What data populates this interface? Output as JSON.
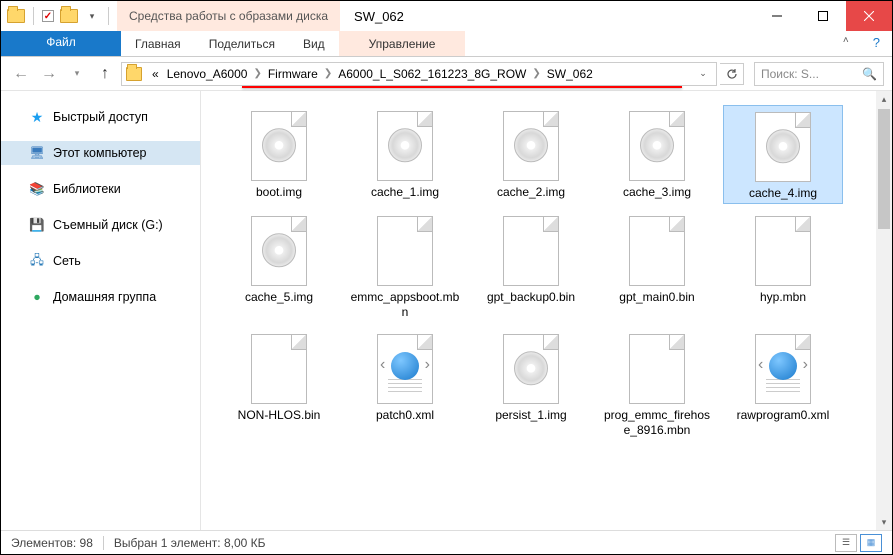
{
  "title_context": "Средства работы с образами диска",
  "title": "SW_062",
  "ribbon": {
    "file": "Файл",
    "home": "Главная",
    "share": "Поделиться",
    "view": "Вид",
    "manage": "Управление"
  },
  "breadcrumb": {
    "prefix": "«",
    "parts": [
      "Lenovo_A6000",
      "Firmware",
      "A6000_L_S062_161223_8G_ROW",
      "SW_062"
    ]
  },
  "search": {
    "placeholder": "Поиск: S..."
  },
  "nav": {
    "quick": "Быстрый доступ",
    "pc": "Этот компьютер",
    "libs": "Библиотеки",
    "removable": "Съемный диск (G:)",
    "network": "Сеть",
    "homegroup": "Домашняя группа"
  },
  "files": [
    {
      "name": "boot.img",
      "type": "disc"
    },
    {
      "name": "cache_1.img",
      "type": "disc"
    },
    {
      "name": "cache_2.img",
      "type": "disc"
    },
    {
      "name": "cache_3.img",
      "type": "disc"
    },
    {
      "name": "cache_4.img",
      "type": "disc",
      "selected": true
    },
    {
      "name": "cache_5.img",
      "type": "disc"
    },
    {
      "name": "emmc_appsboot.mbn",
      "type": "blank"
    },
    {
      "name": "gpt_backup0.bin",
      "type": "blank"
    },
    {
      "name": "gpt_main0.bin",
      "type": "blank"
    },
    {
      "name": "hyp.mbn",
      "type": "blank"
    },
    {
      "name": "NON-HLOS.bin",
      "type": "blank"
    },
    {
      "name": "patch0.xml",
      "type": "xml"
    },
    {
      "name": "persist_1.img",
      "type": "disc"
    },
    {
      "name": "prog_emmc_firehose_8916.mbn",
      "type": "blank"
    },
    {
      "name": "rawprogram0.xml",
      "type": "xml"
    }
  ],
  "status": {
    "count_label": "Элементов:",
    "count": "98",
    "selection": "Выбран 1 элемент: 8,00 КБ"
  }
}
